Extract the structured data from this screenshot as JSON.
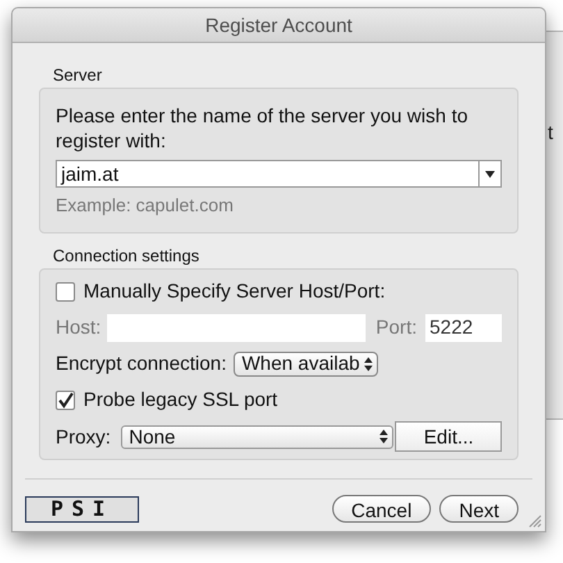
{
  "background_window": {
    "text": "t"
  },
  "window": {
    "title": "Register Account"
  },
  "server": {
    "label": "Server",
    "prompt": "Please enter the name of the server you wish to register with:",
    "value": "jaim.at",
    "example": "Example: capulet.com"
  },
  "connection": {
    "label": "Connection settings",
    "manual": {
      "label": "Manually Specify Server Host/Port:",
      "checked": false
    },
    "host": {
      "label": "Host:"
    },
    "port": {
      "label": "Port:",
      "value": "5222"
    },
    "encrypt": {
      "label": "Encrypt connection:",
      "value": "When availab"
    },
    "probe": {
      "label": "Probe legacy SSL port",
      "checked": true
    },
    "proxy": {
      "label": "Proxy:",
      "value": "None",
      "button": "Edit..."
    }
  },
  "logo": "PSI",
  "buttons": [
    "Cancel",
    "Next"
  ]
}
